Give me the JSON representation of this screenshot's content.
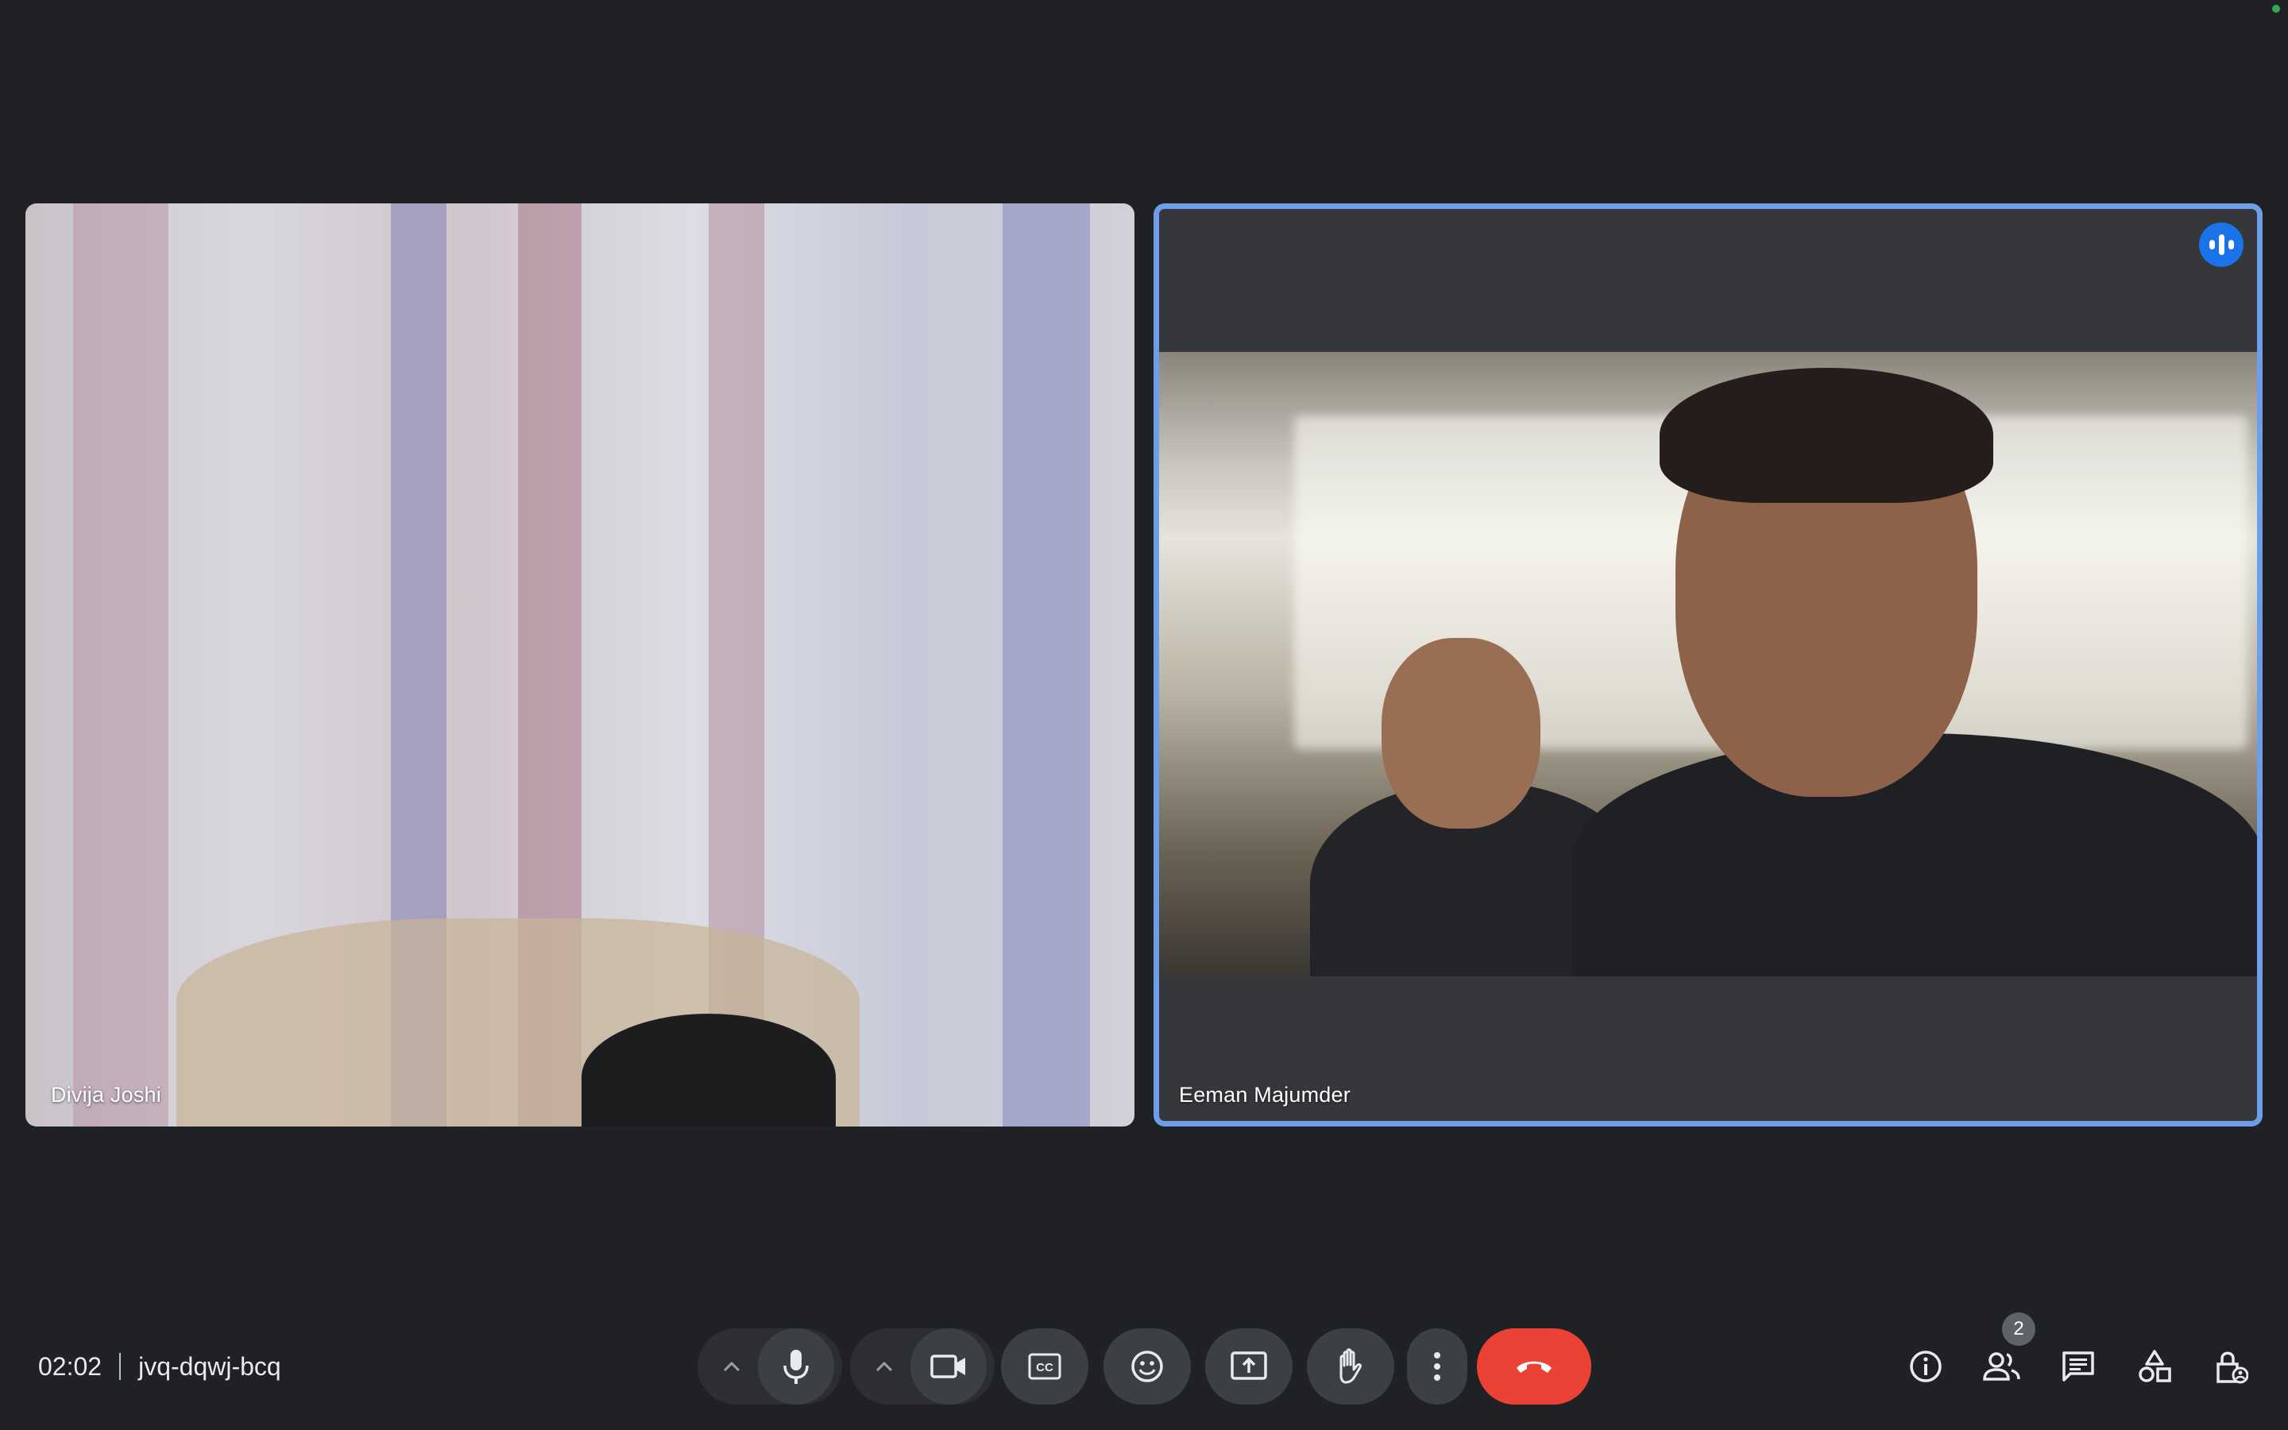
{
  "meeting": {
    "time": "02:02",
    "code": "jvq-dqwj-bcq"
  },
  "participants": [
    {
      "name": "Divija Joshi"
    },
    {
      "name": "Eeman Majumder"
    }
  ],
  "people_count": "2",
  "controls": {
    "mic": "microphone-icon",
    "camera": "camera-icon",
    "captions": "captions-icon",
    "reactions": "emoji-icon",
    "present": "present-screen-icon",
    "raise_hand": "hand-icon",
    "more": "more-vert-icon",
    "leave": "end-call-icon"
  },
  "side_controls": [
    "info-icon",
    "people-icon",
    "chat-icon",
    "activities-icon",
    "host-controls-icon"
  ],
  "colors": {
    "background": "#202124",
    "active_speaker_border": "#6e9ee8",
    "end_call": "#ea4335",
    "speaking_indicator": "#1a73e8"
  }
}
